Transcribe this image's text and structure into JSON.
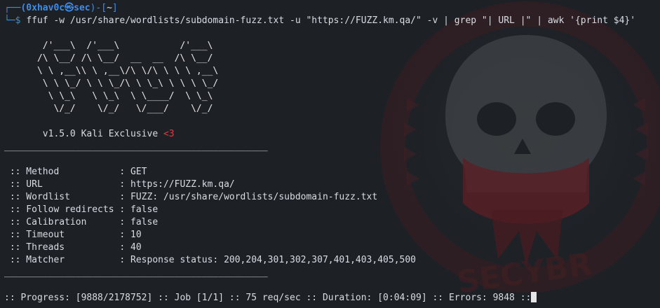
{
  "prompt": {
    "user_host": "(0xhav0c",
    "at_icon": "㉿",
    "host": "sec",
    "dir": "~",
    "symbol": "$",
    "command": "ffuf -w /usr/share/wordlists/subdomain-fuzz.txt -u \"https://FUZZ.km.qa/\" -v | grep \"| URL |\" | awk '{print $4}'"
  },
  "banner": [
    "       /'___\\  /'___\\           /'___\\",
    "      /\\ \\__/ /\\ \\__/  __  __  /\\ \\__/",
    "      \\ \\ ,__\\\\ \\ ,__\\/\\ \\/\\ \\ \\ \\ ,__\\",
    "       \\ \\ \\_/ \\ \\ \\_/\\ \\ \\_\\ \\ \\ \\ \\_/",
    "        \\ \\_\\   \\ \\_\\  \\ \\____/  \\ \\_\\",
    "         \\/_/    \\/_/   \\/___/    \\/_/"
  ],
  "version": {
    "text": "       v1.5.0 Kali Exclusive ",
    "heart": "<3"
  },
  "separator": "________________________________________________",
  "config": [
    {
      "key": " :: Method           : ",
      "value": "GET"
    },
    {
      "key": " :: URL              : ",
      "value": "https://FUZZ.km.qa/"
    },
    {
      "key": " :: Wordlist         : ",
      "value": "FUZZ: /usr/share/wordlists/subdomain-fuzz.txt"
    },
    {
      "key": " :: Follow redirects : ",
      "value": "false"
    },
    {
      "key": " :: Calibration      : ",
      "value": "false"
    },
    {
      "key": " :: Timeout          : ",
      "value": "10"
    },
    {
      "key": " :: Threads          : ",
      "value": "40"
    },
    {
      "key": " :: Matcher          : ",
      "value": "Response status: 200,204,301,302,307,401,403,405,500"
    }
  ],
  "progress_line": ":: Progress: [9888/2178752] :: Job [1/1] :: 75 req/sec :: Duration: [0:04:09] :: Errors: 9848 ::",
  "watermark": {
    "text": "SECYBR",
    "icon": "skull-logo-icon"
  },
  "colors": {
    "background": "#1d2126",
    "prompt": "#3f8ce8",
    "heart": "#e03a3a"
  }
}
